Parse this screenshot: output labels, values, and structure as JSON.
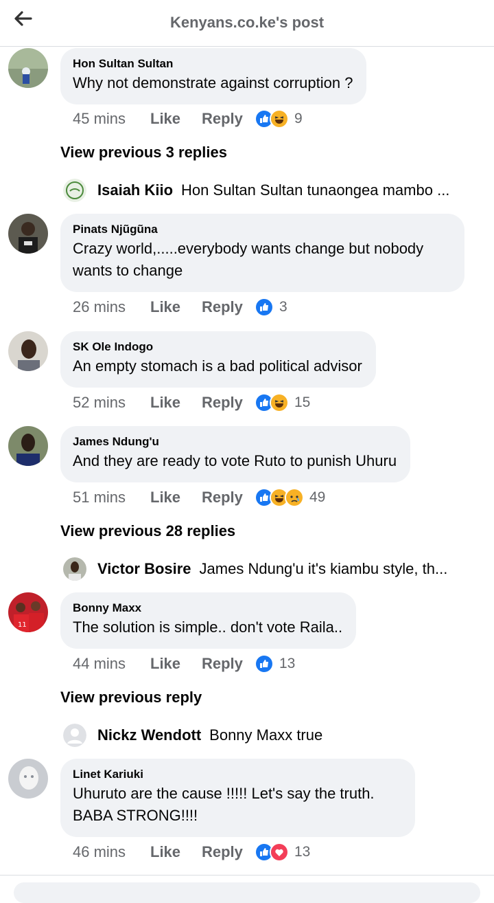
{
  "header": {
    "title": "Kenyans.co.ke's post",
    "back_icon": "back-arrow-icon"
  },
  "comments": [
    {
      "author": "Hon Sultan Sultan",
      "text": "Why not demonstrate against corruption ?",
      "time": "45 mins",
      "like": "Like",
      "reply": "Reply",
      "reactions": [
        "like",
        "haha"
      ],
      "count": "9"
    },
    {
      "author": "Pinats  Njũgũna",
      "text": "Crazy world,.....everybody wants change but nobody wants to change",
      "time": "26 mins",
      "like": "Like",
      "reply": "Reply",
      "reactions": [
        "like"
      ],
      "count": "3"
    },
    {
      "author": "SK Ole Indogo",
      "text": "An empty stomach is a bad political advisor",
      "time": "52 mins",
      "like": "Like",
      "reply": "Reply",
      "reactions": [
        "like",
        "haha"
      ],
      "count": "15"
    },
    {
      "author": "James Ndung'u",
      "text": "And they are ready to vote Ruto to punish Uhuru",
      "time": "51 mins",
      "like": "Like",
      "reply": "Reply",
      "reactions": [
        "like",
        "haha",
        "sad"
      ],
      "count": "49"
    },
    {
      "author": "Bonny Maxx",
      "text": "The solution is simple.. don't vote Raila..",
      "time": "44 mins",
      "like": "Like",
      "reply": "Reply",
      "reactions": [
        "like"
      ],
      "count": "13"
    },
    {
      "author": "Linet Kariuki",
      "text": "Uhuruto are the cause !!!!! Let's say the truth. BABA STRONG!!!!",
      "time": "46 mins",
      "like": "Like",
      "reply": "Reply",
      "reactions": [
        "like",
        "love"
      ],
      "count": "13"
    }
  ],
  "view_previous": [
    "View previous 3 replies",
    "View previous 28 replies",
    "View previous reply"
  ],
  "subreplies": [
    {
      "author": "Isaiah Kiio",
      "text": "Hon Sultan Sultan tunaongea mambo ..."
    },
    {
      "author": "Victor Bosire",
      "text": "James Ndung'u it's kiambu style, th..."
    },
    {
      "author": "Nickz Wendott",
      "text": "Bonny Maxx true"
    }
  ],
  "colors": {
    "like": "#1877f2",
    "haha": "#f7b125",
    "sad": "#f7b125",
    "love": "#f33e58",
    "meta": "#65676b",
    "bubble": "#f0f2f5"
  }
}
